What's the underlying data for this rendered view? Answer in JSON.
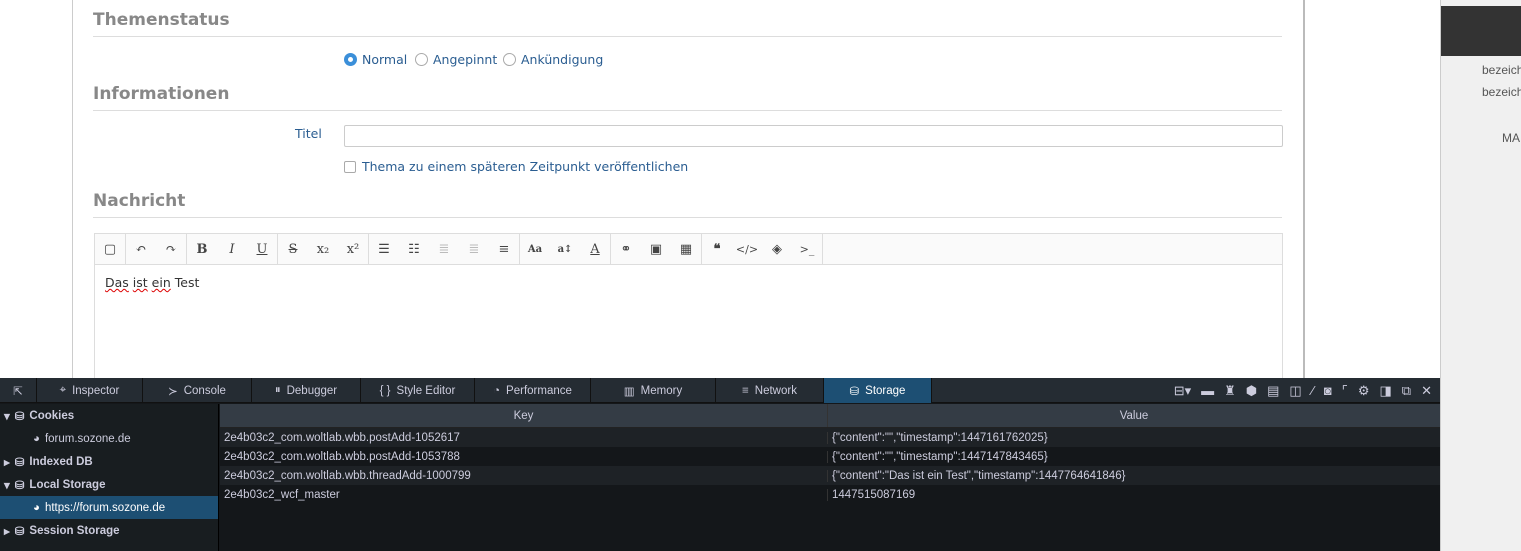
{
  "form": {
    "section_status": "Themenstatus",
    "radios": [
      {
        "label": "Normal",
        "checked": true
      },
      {
        "label": "Angepinnt",
        "checked": false
      },
      {
        "label": "Ankündigung",
        "checked": false
      }
    ],
    "section_info": "Informationen",
    "title_label": "Titel",
    "title_value": "",
    "schedule_label": "Thema zu einem späteren Zeitpunkt veröffentlichen",
    "section_message": "Nachricht",
    "editor_words": [
      "Das",
      "ist",
      "ein",
      "Test"
    ]
  },
  "right_panel": {
    "texts": [
      "bezeich",
      "bezeich",
      "MA"
    ]
  },
  "devtools": {
    "tabs": [
      {
        "icon": "⌖",
        "label": "Inspector"
      },
      {
        "icon": "≻",
        "label": "Console"
      },
      {
        "icon": "⏸",
        "label": "Debugger"
      },
      {
        "icon": "{ }",
        "label": "Style Editor"
      },
      {
        "icon": "◔",
        "label": "Performance"
      },
      {
        "icon": "▥",
        "label": "Memory"
      },
      {
        "icon": "≡",
        "label": "Network"
      },
      {
        "icon": "⛁",
        "label": "Storage"
      }
    ],
    "sidebar": [
      {
        "label": "Cookies",
        "type": "group",
        "open": true
      },
      {
        "label": "forum.sozone.de",
        "type": "host"
      },
      {
        "label": "Indexed DB",
        "type": "group",
        "open": false
      },
      {
        "label": "Local Storage",
        "type": "group",
        "open": true
      },
      {
        "label": "https://forum.sozone.de",
        "type": "host",
        "selected": true
      },
      {
        "label": "Session Storage",
        "type": "group",
        "open": false
      }
    ],
    "columns": [
      "Key",
      "Value"
    ],
    "rows": [
      [
        "2e4b03c2_com.woltlab.wbb.postAdd-1052617",
        "{\"content\":\"\",\"timestamp\":1447161762025}"
      ],
      [
        "2e4b03c2_com.woltlab.wbb.postAdd-1053788",
        "{\"content\":\"\",\"timestamp\":1447147843465}"
      ],
      [
        "2e4b03c2_com.woltlab.wbb.threadAdd-1000799",
        "{\"content\":\"Das ist ein Test\",\"timestamp\":1447764641846}"
      ],
      [
        "2e4b03c2_wcf_master",
        "1447515087169"
      ]
    ],
    "tool_icons": [
      "split-console",
      "scratchpad",
      "paint-flashing",
      "3d-view",
      "responsive",
      "screenshot-frame",
      "eyedropper",
      "camera",
      "rulers",
      "settings",
      "dock-side",
      "undock",
      "close"
    ]
  }
}
